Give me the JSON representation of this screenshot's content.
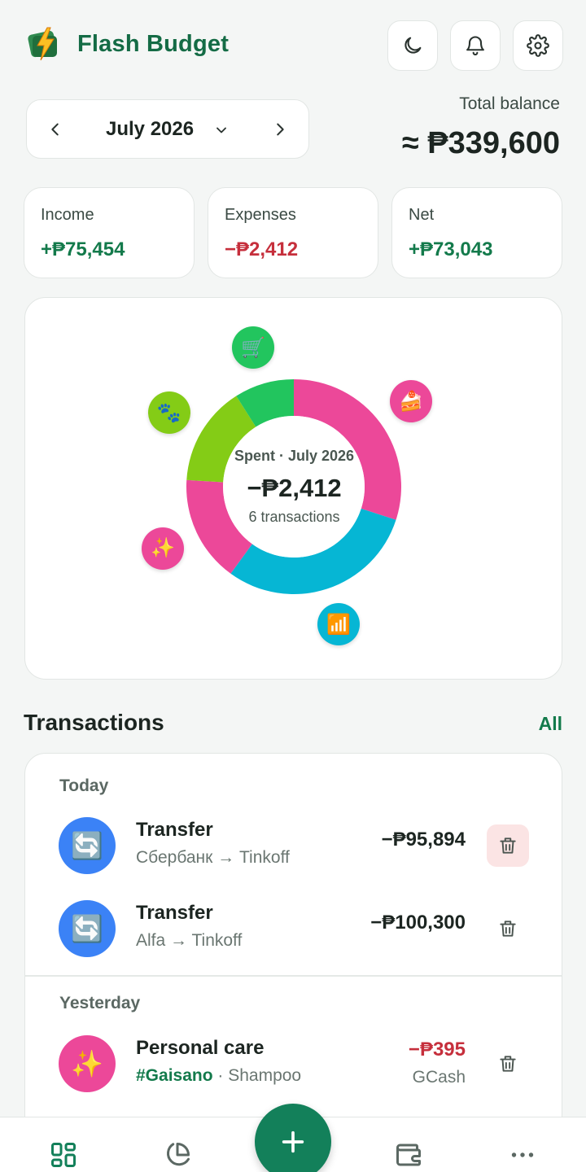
{
  "app": {
    "title": "Flash Budget"
  },
  "header": {
    "theme_icon": "moon-icon",
    "notif_icon": "bell-icon",
    "settings_icon": "gear-icon"
  },
  "period": {
    "label": "July 2026"
  },
  "balance": {
    "label": "Total balance",
    "value": "≈ ₱339,600"
  },
  "summary": [
    {
      "label": "Income",
      "value": "+₱75,454",
      "color": "#137a4b"
    },
    {
      "label": "Expenses",
      "value": "−₱2,412",
      "color": "#c62f3c"
    },
    {
      "label": "Net",
      "value": "+₱73,043",
      "color": "#137a4b"
    }
  ],
  "chart": {
    "title": "Spent · July 2026",
    "value": "−₱2,412",
    "subtitle": "6 transactions"
  },
  "chart_data": {
    "type": "pie",
    "title": "Spent · July 2026",
    "categories": [
      "Cake",
      "Internet",
      "Personal care",
      "Pets",
      "Groceries"
    ],
    "icons": [
      "🍰",
      "📶",
      "✨",
      "🐾",
      "🛒"
    ],
    "values": [
      30,
      30,
      16,
      15,
      9
    ],
    "colors": [
      "#ec4899",
      "#06b6d4",
      "#ec4899",
      "#84cc16",
      "#22c55e"
    ]
  },
  "transactions": {
    "heading": "Transactions",
    "all_link": "All",
    "groups": [
      {
        "day": "Today",
        "items": [
          {
            "icon": "🔄",
            "icon_bg": "#3b82f6",
            "title": "Transfer",
            "sub": "Сбербанк → Tinkoff",
            "amount": "−₱95,894"
          },
          {
            "icon": "🔄",
            "icon_bg": "#3b82f6",
            "title": "Transfer",
            "sub": "Alfa → Tinkoff",
            "amount": "−₱100,300"
          }
        ]
      },
      {
        "day": "Yesterday",
        "items": [
          {
            "icon": "✨",
            "icon_bg": "#ec4899",
            "title": "Personal care",
            "tag": "#Gaisano",
            "sub": " · Shampoo",
            "amount": "−₱395",
            "account": "GCash"
          }
        ]
      }
    ]
  },
  "nav": {
    "items": [
      "dashboard-icon",
      "pie-chart-icon",
      "plus-icon",
      "wallet-icon",
      "more-icon"
    ]
  }
}
